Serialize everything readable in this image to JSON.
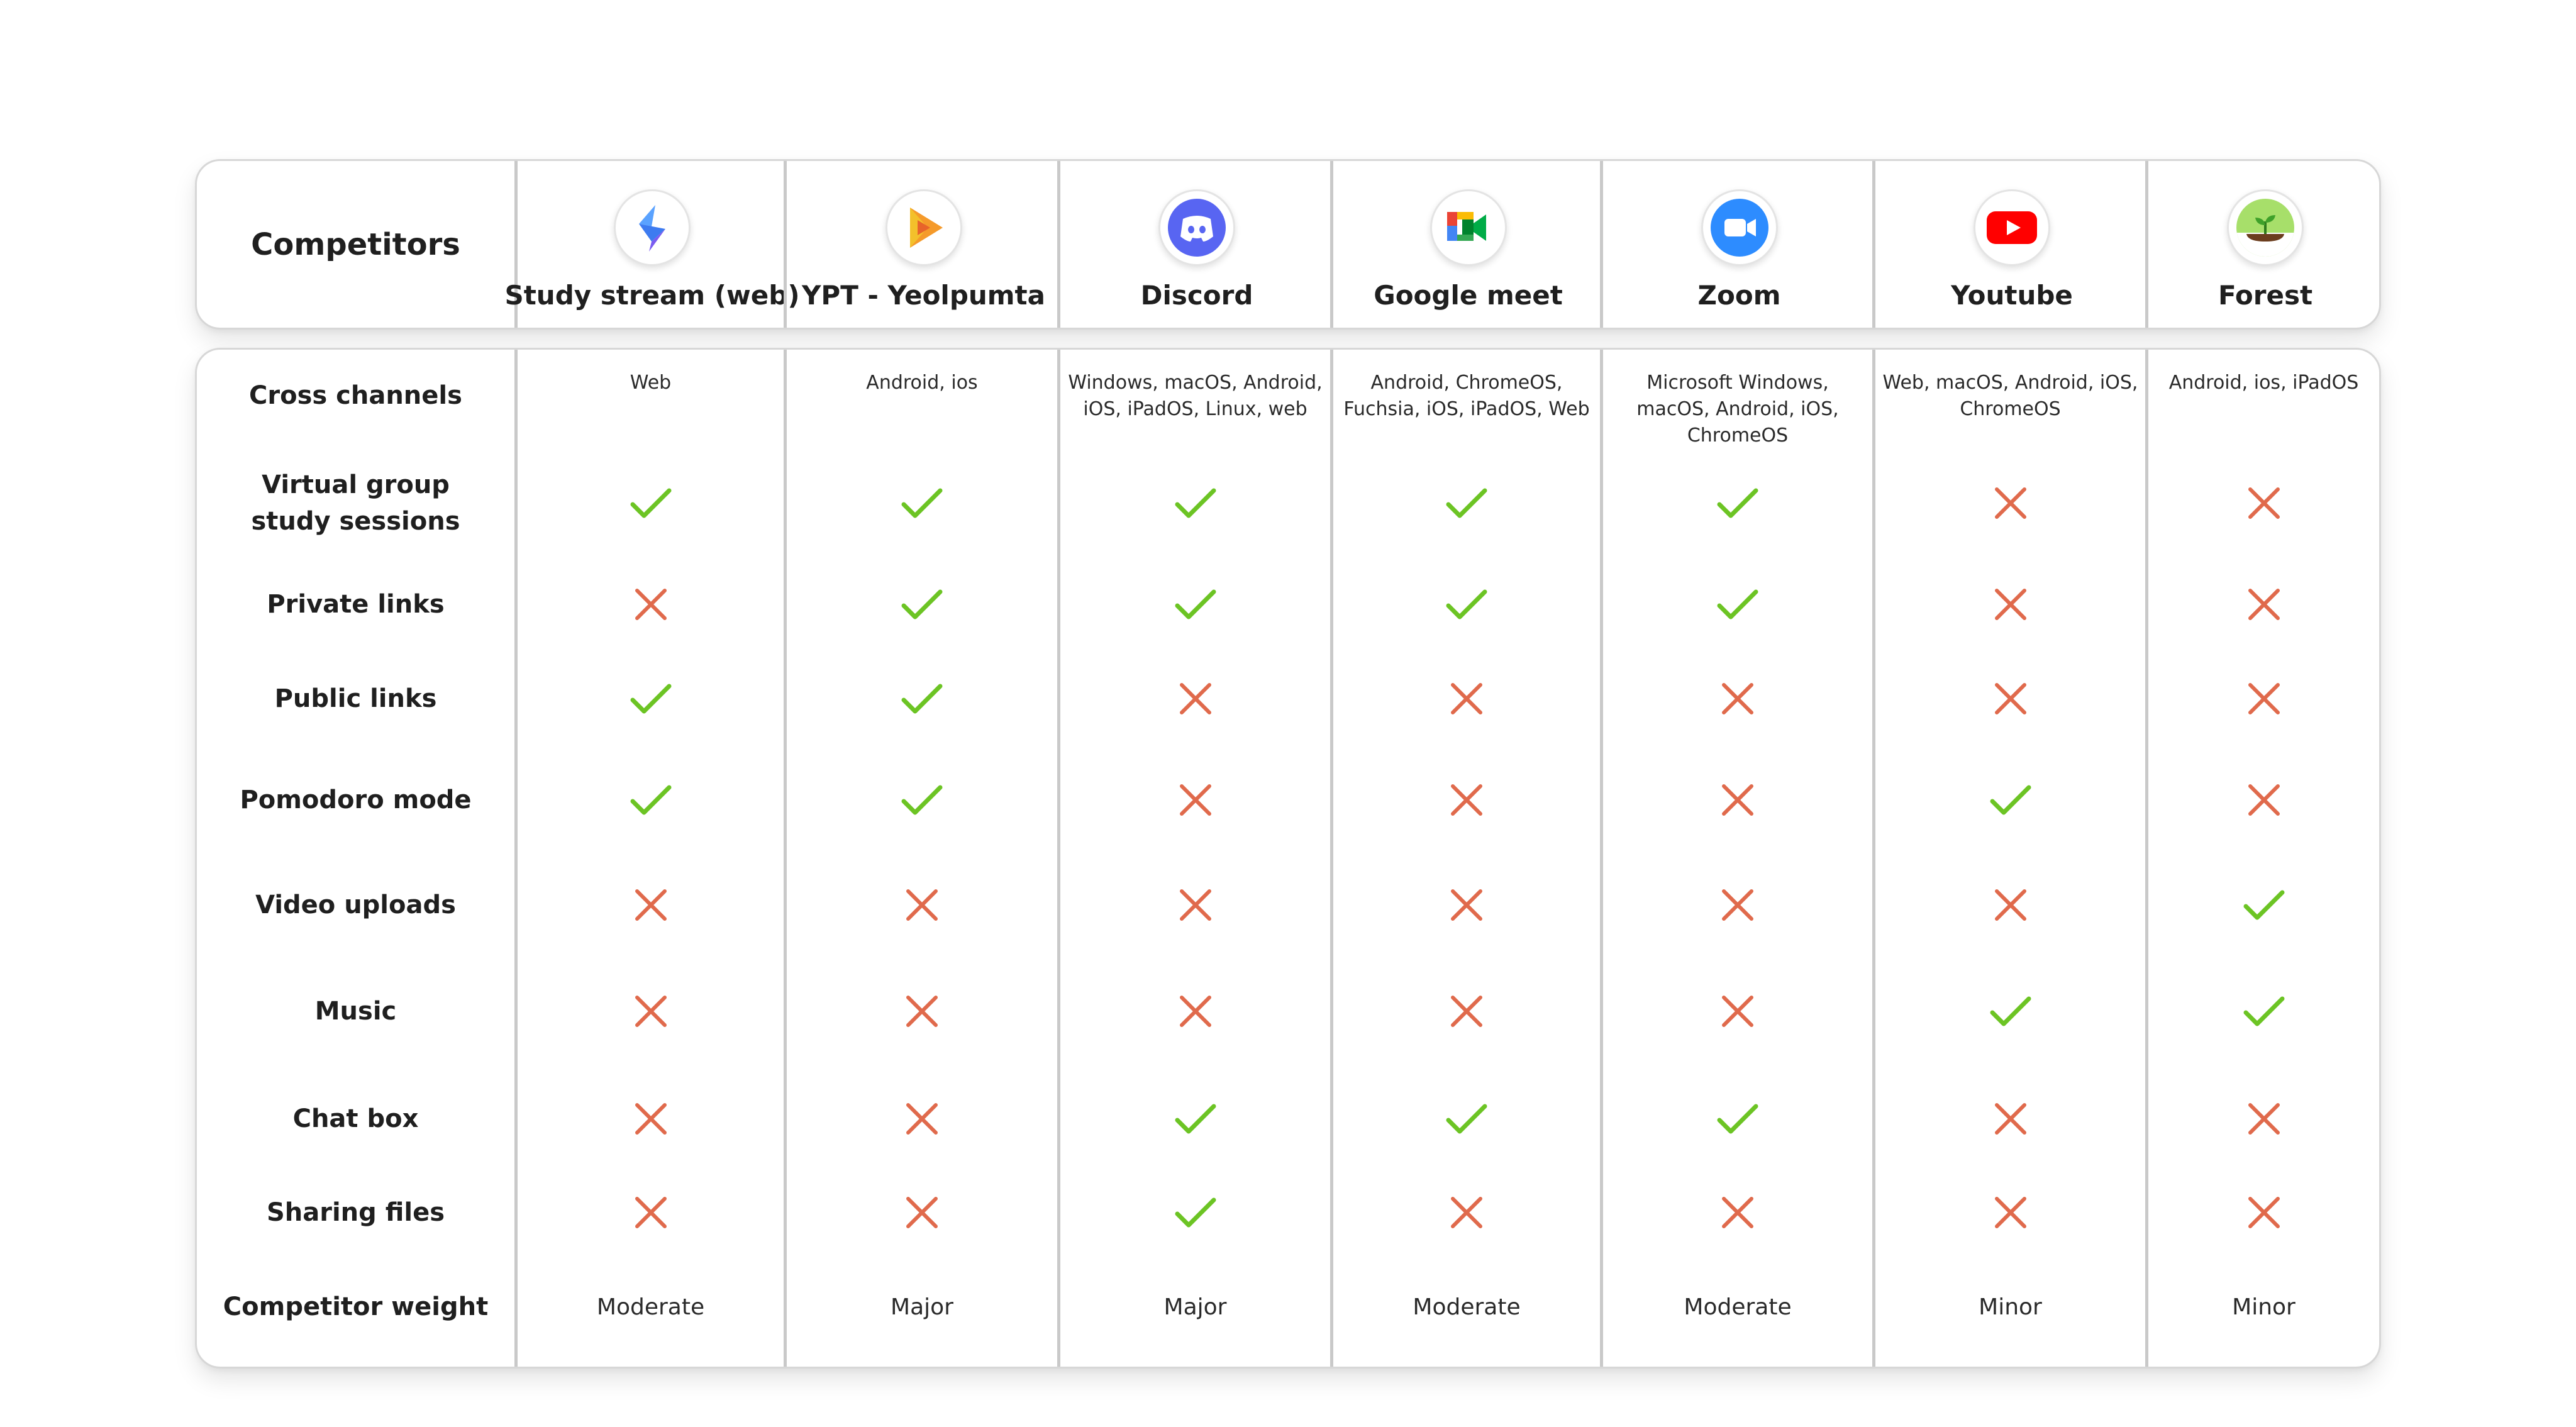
{
  "header": {
    "title": "Competitors",
    "competitors": [
      {
        "name": "Study stream (web)",
        "icon": "study-stream-logo-icon"
      },
      {
        "name": "YPT - Yeolpumta",
        "icon": "ypt-logo-icon"
      },
      {
        "name": "Discord",
        "icon": "discord-logo-icon"
      },
      {
        "name": "Google meet",
        "icon": "google-meet-logo-icon"
      },
      {
        "name": "Zoom",
        "icon": "zoom-logo-icon"
      },
      {
        "name": "Youtube",
        "icon": "youtube-logo-icon"
      },
      {
        "name": "Forest",
        "icon": "forest-logo-icon"
      }
    ]
  },
  "rows": [
    {
      "label": "Cross channels",
      "type": "text",
      "cells": [
        "Web",
        "Android, ios",
        "Windows, macOS, Android,\niOS, iPadOS, Linux, web",
        "Android, ChromeOS,\nFuchsia, iOS, iPadOS, Web",
        "Microsoft Windows,\nmacOS, Android, iOS,\nChromeOS",
        "Web, macOS, Android, iOS,\nChromeOS",
        "Android, ios, iPadOS"
      ]
    },
    {
      "label": "Virtual group\nstudy sessions",
      "type": "bool",
      "cells": [
        true,
        true,
        true,
        true,
        true,
        false,
        false
      ]
    },
    {
      "label": "Private links",
      "type": "bool",
      "cells": [
        false,
        true,
        true,
        true,
        true,
        false,
        false
      ]
    },
    {
      "label": "Public links",
      "type": "bool",
      "cells": [
        true,
        true,
        false,
        false,
        false,
        false,
        false
      ]
    },
    {
      "label": "Pomodoro mode",
      "type": "bool",
      "cells": [
        true,
        true,
        false,
        false,
        false,
        true,
        false
      ]
    },
    {
      "label": "Video uploads",
      "type": "bool",
      "cells": [
        false,
        false,
        false,
        false,
        false,
        false,
        true
      ]
    },
    {
      "label": "Music",
      "type": "bool",
      "cells": [
        false,
        false,
        false,
        false,
        false,
        true,
        true
      ]
    },
    {
      "label": "Chat box",
      "type": "bool",
      "cells": [
        false,
        false,
        true,
        true,
        true,
        false,
        false
      ]
    },
    {
      "label": "Sharing files",
      "type": "bool",
      "cells": [
        false,
        false,
        true,
        false,
        false,
        false,
        false
      ]
    },
    {
      "label": "Competitor weight",
      "type": "text",
      "cells": [
        "Moderate",
        "Major",
        "Major",
        "Moderate",
        "Moderate",
        "Minor",
        "Minor"
      ]
    }
  ],
  "colors": {
    "check": "#6cc424",
    "cross": "#e06a4c",
    "divider": "#c9c9c9"
  },
  "icons": {
    "check": "check-icon",
    "cross": "cross-icon"
  }
}
